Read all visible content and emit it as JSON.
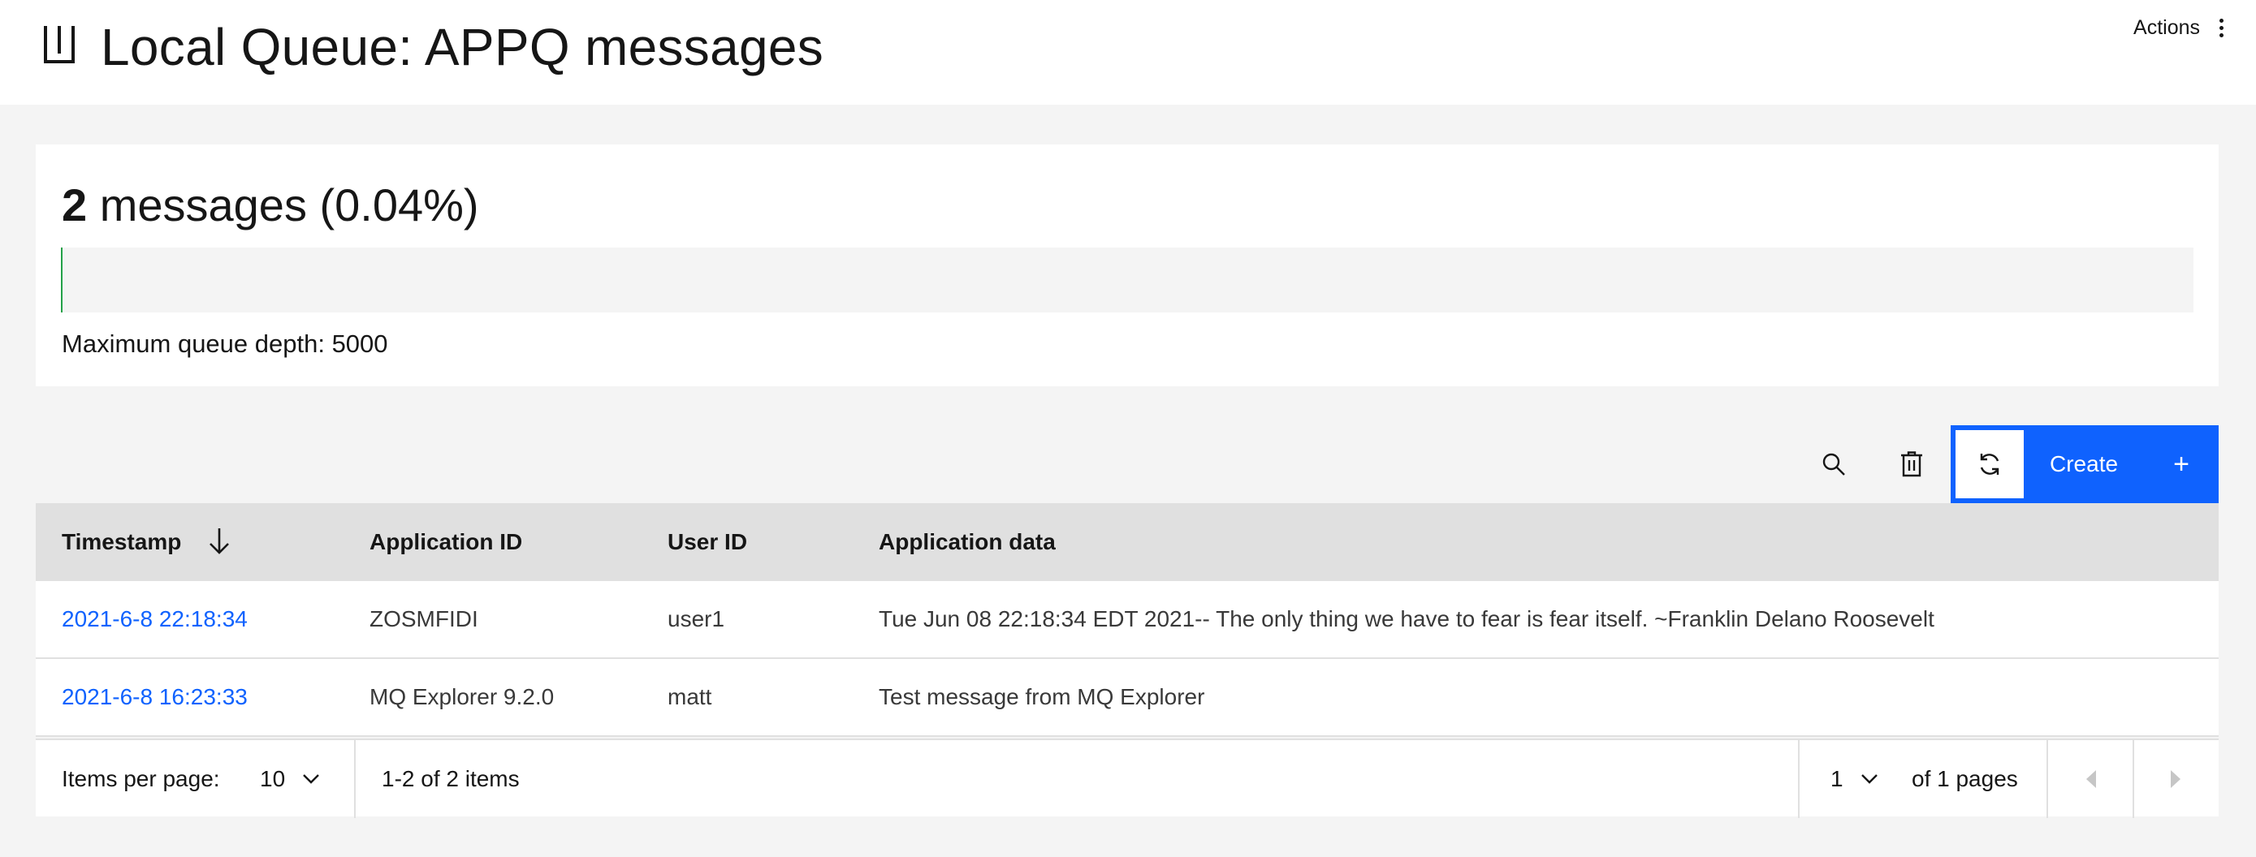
{
  "header": {
    "title": "Local Queue: APPQ messages",
    "actions_label": "Actions"
  },
  "depth": {
    "count": "2",
    "suffix": " messages (0.04%)",
    "fill_percent": 0.04,
    "max_depth_label": "Maximum queue depth: 5000"
  },
  "toolbar": {
    "create_label": "Create",
    "create_plus": "+"
  },
  "table": {
    "columns": [
      "Timestamp",
      "Application ID",
      "User ID",
      "Application data"
    ],
    "rows": [
      {
        "timestamp": "2021-6-8 22:18:34",
        "application_id": "ZOSMFIDI",
        "user_id": "user1",
        "application_data": "Tue Jun 08 22:18:34 EDT 2021-- The only thing we have to fear is fear itself. ~Franklin Delano Roosevelt"
      },
      {
        "timestamp": "2021-6-8 16:23:33",
        "application_id": "MQ Explorer 9.2.0",
        "user_id": "matt",
        "application_data": "Test message from MQ Explorer"
      }
    ]
  },
  "pagination": {
    "items_per_page_label": "Items per page:",
    "items_per_page_value": "10",
    "range_text": "1-2 of 2 items",
    "page_value": "1",
    "of_pages_text": "of 1 pages"
  },
  "colors": {
    "accent": "#0f62fe",
    "depth_fill": "#24a148",
    "header_row_bg": "#e0e0e0",
    "page_bg": "#f4f4f4"
  },
  "icons": {
    "title": "local-queue-icon",
    "actions": "overflow-menu-icon",
    "sort": "arrow-down-icon",
    "search": "search-icon",
    "delete": "trash-icon",
    "refresh": "refresh-icon",
    "dropdown": "chevron-down-icon",
    "prev": "caret-left-icon",
    "next": "caret-right-icon"
  }
}
